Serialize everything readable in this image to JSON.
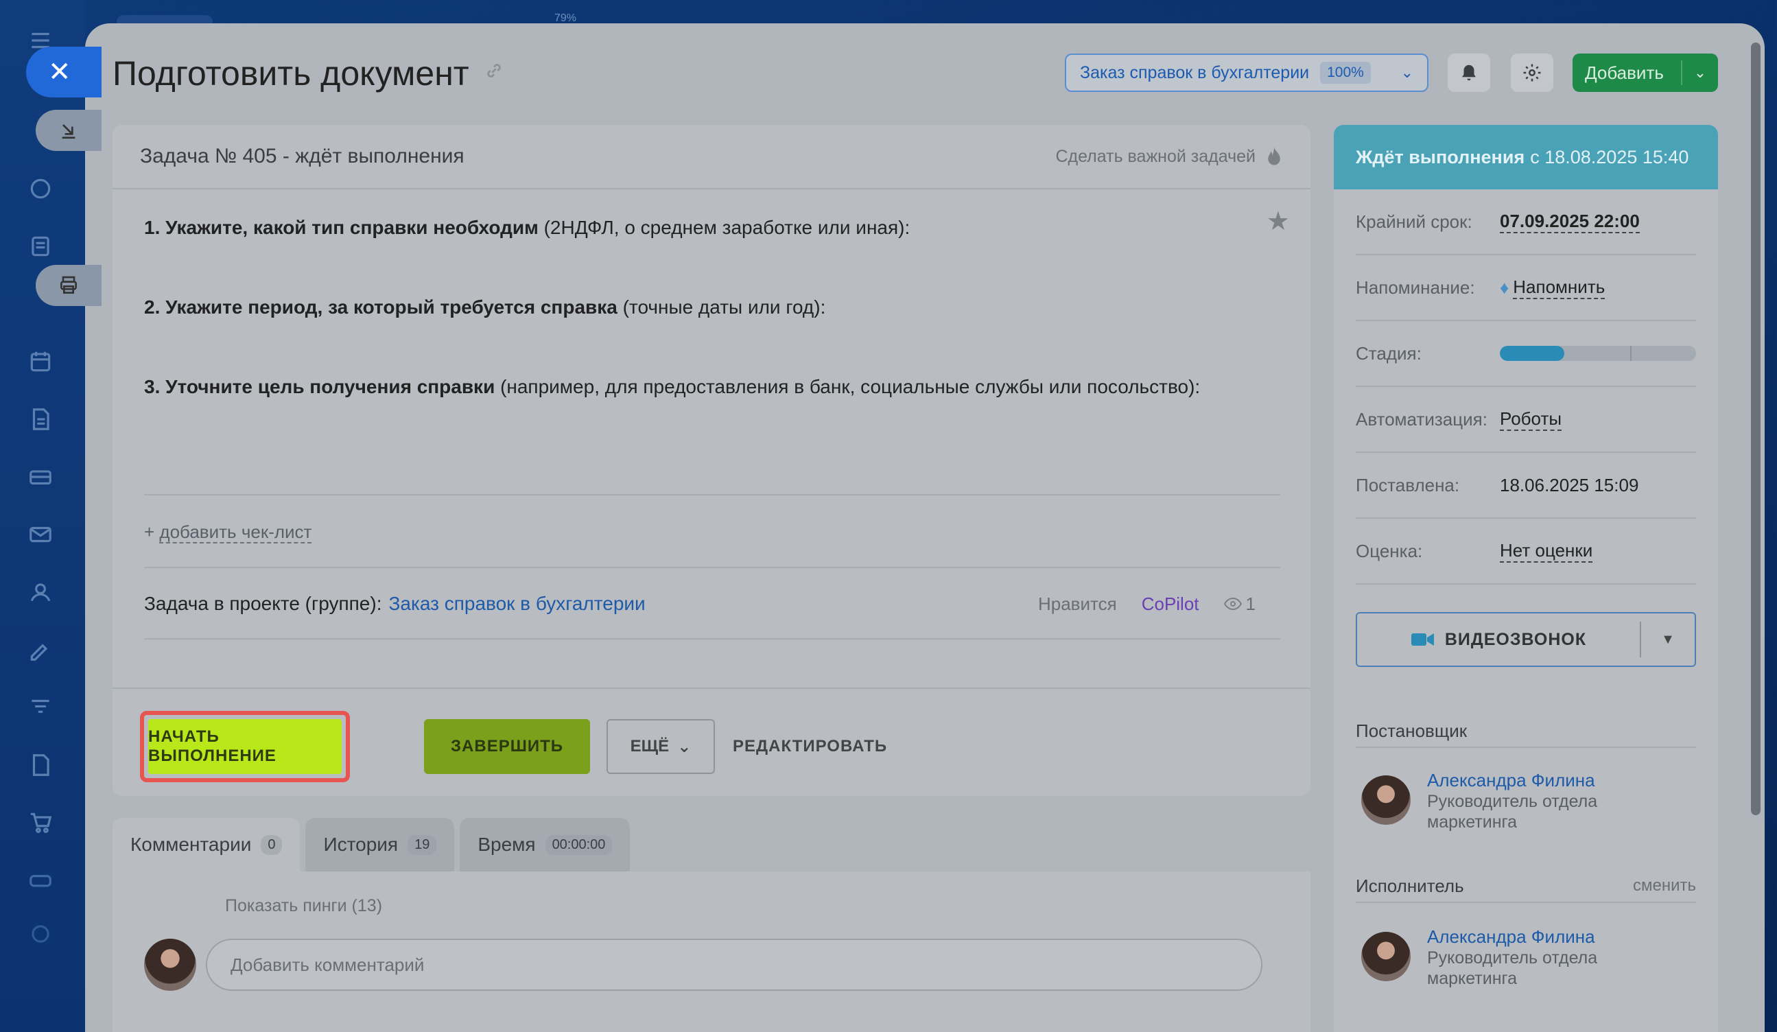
{
  "zoom_indicator": "79%",
  "page_title": "Подготовить документ",
  "project_pill": {
    "label": "Заказ справок в бухгалтерии",
    "percent": "100%"
  },
  "add_button": "Добавить",
  "task": {
    "header": "Задача № 405 - ждёт выполнения",
    "make_important": "Сделать важной задачей",
    "lines": [
      {
        "bold": "1. Укажите, какой тип справки необходим",
        "rest": " (2НДФЛ, о среднем заработке или иная):"
      },
      {
        "bold": "2. Укажите период, за который требуется справка",
        "rest": " (точные даты или год):"
      },
      {
        "bold": "3. Уточните цель получения справки",
        "rest": " (например, для предоставления в банк, социальные службы или посольство):"
      }
    ],
    "add_checklist_prefix": "+ ",
    "add_checklist": "добавить чек-лист",
    "project_label": "Задача в проекте (группе):",
    "project_link": "Заказ справок в бухгалтерии",
    "like": "Нравится",
    "copilot": "CoPilot",
    "views": "1"
  },
  "actions": {
    "start": "НАЧАТЬ ВЫПОЛНЕНИЕ",
    "finish": "ЗАВЕРШИТЬ",
    "more": "ЕЩЁ",
    "edit": "РЕДАКТИРОВАТЬ"
  },
  "tabs": [
    {
      "label": "Комментарии",
      "count": "0"
    },
    {
      "label": "История",
      "count": "19"
    },
    {
      "label": "Время",
      "count": "00:00:00"
    }
  ],
  "comments": {
    "show_pings": "Показать пинги (13)",
    "placeholder": "Добавить комментарий"
  },
  "status": {
    "label": "Ждёт выполнения",
    "since": "с 18.08.2025 15:40"
  },
  "info": {
    "deadline_label": "Крайний срок:",
    "deadline_value": "07.09.2025 22:00",
    "reminder_label": "Напоминание:",
    "reminder_value": "Напомнить",
    "stage_label": "Стадия:",
    "stage_progress": 0.33,
    "automation_label": "Автоматизация:",
    "automation_value": "Роботы",
    "created_label": "Поставлена:",
    "created_value": "18.06.2025 15:09",
    "rating_label": "Оценка:",
    "rating_value": "Нет оценки"
  },
  "video_call": "ВИДЕОЗВОНОК",
  "creator": {
    "title": "Постановщик",
    "name": "Александра Филина",
    "role": "Руководитель отдела маркетинга"
  },
  "assignee": {
    "title": "Исполнитель",
    "change": "сменить",
    "name": "Александра Филина",
    "role": "Руководитель отдела маркетинга"
  },
  "colors": {
    "accent": "#b8e81a",
    "status": "#4aa2b6",
    "success": "#1e8a48",
    "highlight": "#e65550"
  }
}
